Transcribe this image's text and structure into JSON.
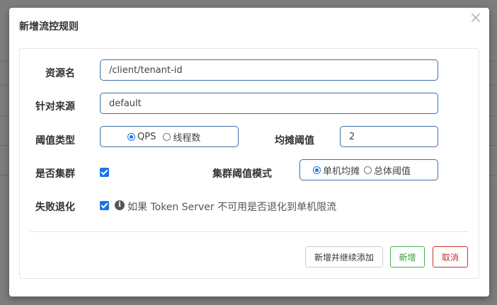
{
  "dialog": {
    "title": "新增流控规则",
    "close_icon": "×"
  },
  "form": {
    "resource_label": "资源名",
    "resource_value": "/client/tenant-id",
    "origin_label": "针对来源",
    "origin_value": "default",
    "threshold_type_label": "阈值类型",
    "threshold_type_options": [
      "QPS",
      "线程数"
    ],
    "threshold_type_selected": "QPS",
    "avg_threshold_label": "均摊阈值",
    "avg_threshold_value": "2",
    "cluster_label": "是否集群",
    "cluster_checked": true,
    "cluster_mode_label": "集群阈值模式",
    "cluster_mode_options": [
      "单机均摊",
      "总体阈值"
    ],
    "cluster_mode_selected": "单机均摊",
    "fallback_label": "失败退化",
    "fallback_checked": true,
    "fallback_hint": "如果 Token Server 不可用是否退化到单机限流"
  },
  "buttons": {
    "add_continue": "新增并继续添加",
    "add": "新增",
    "cancel": "取消"
  },
  "colors": {
    "accent": "#1a73e8",
    "input_border": "#3a6ea5",
    "success": "#4cae4c",
    "danger": "#c9302c"
  }
}
